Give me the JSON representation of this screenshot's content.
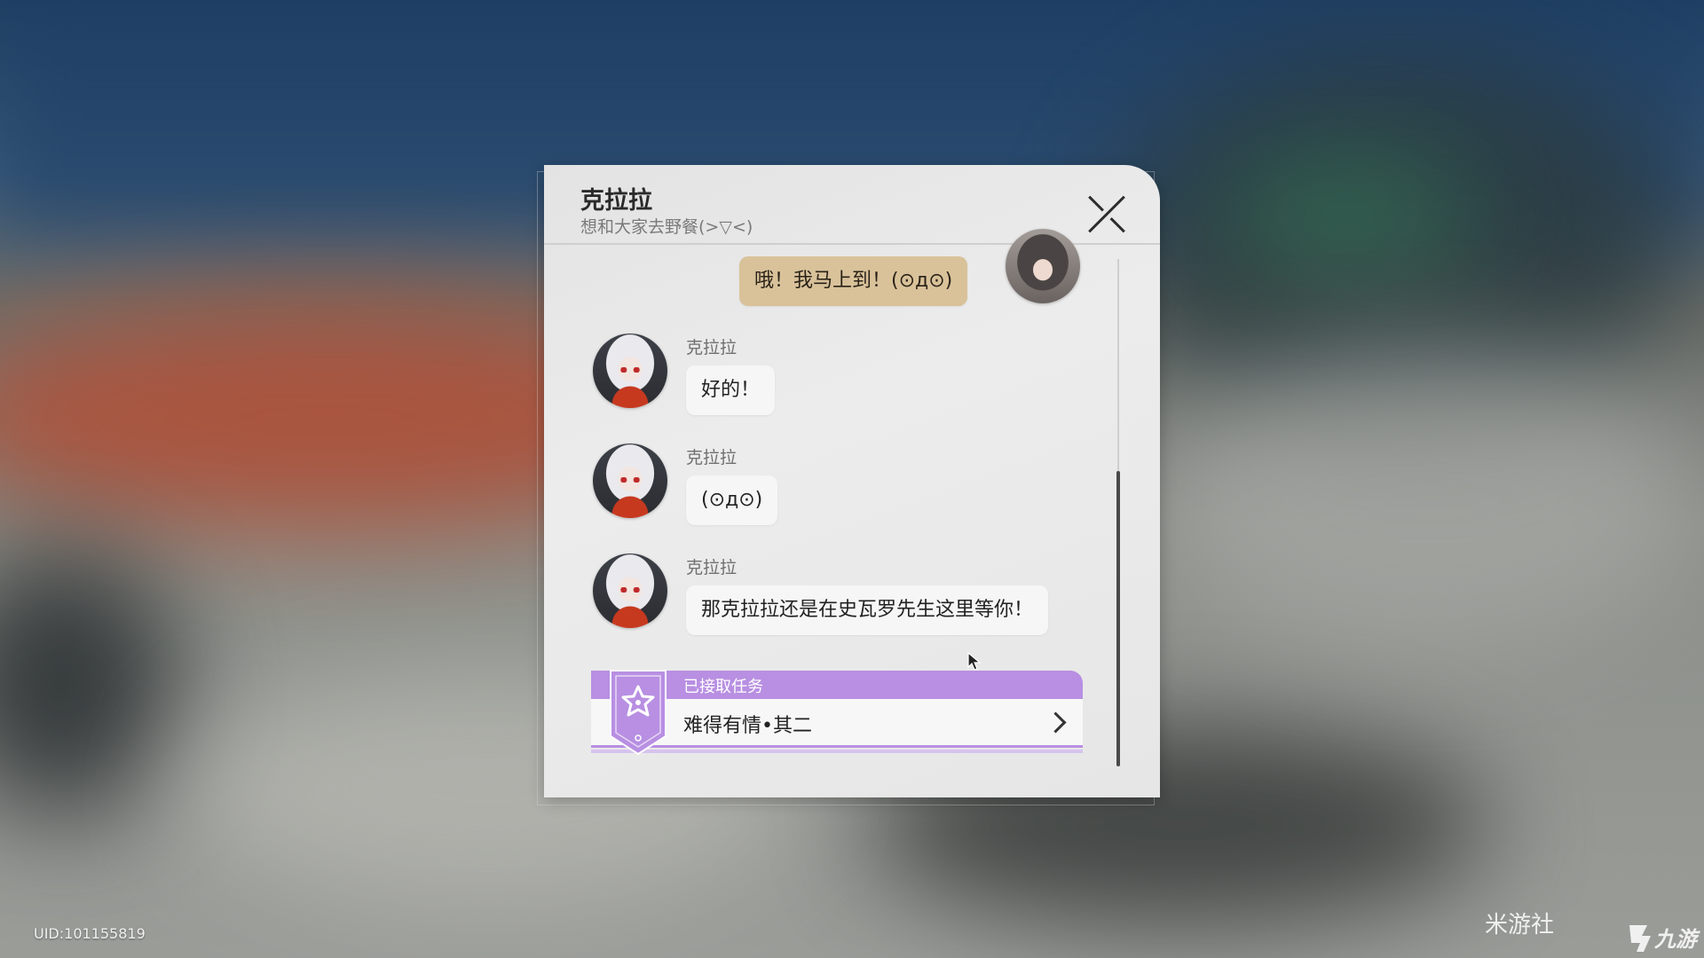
{
  "dialog": {
    "title": "克拉拉",
    "subtitle": "想和大家去野餐(>▽<)"
  },
  "messages": [
    {
      "from": "player",
      "text": "哦！我马上到！(⊙д⊙)"
    },
    {
      "from": "npc",
      "name": "克拉拉",
      "text": "好的！"
    },
    {
      "from": "npc",
      "name": "克拉拉",
      "text": "(⊙д⊙)"
    },
    {
      "from": "npc",
      "name": "克拉拉",
      "text": "那克拉拉还是在史瓦罗先生这里等你！"
    }
  ],
  "quest": {
    "status_label": "已接取任务",
    "title": "难得有情•其二"
  },
  "footer": {
    "uid": "UID:101155819",
    "watermark_left": "米游社",
    "watermark_right": "九游"
  },
  "colors": {
    "quest_accent": "#b88fe2",
    "player_bubble": "#d9c29a",
    "npc_bubble": "#f6f6f6"
  }
}
